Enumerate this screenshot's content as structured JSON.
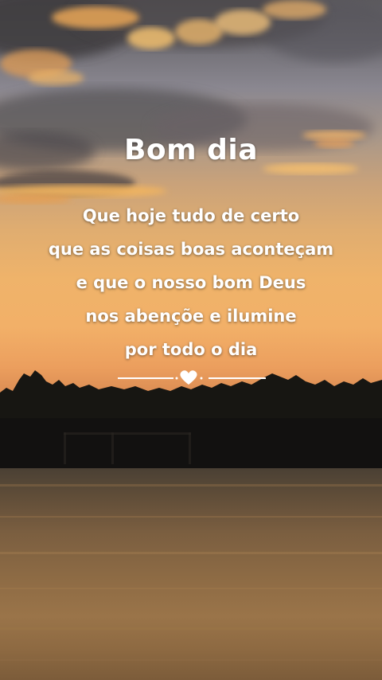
{
  "greeting": {
    "title": "Bom dia",
    "lines": [
      "Que hoje tudo de certo",
      "que as coisas boas aconteçam",
      "e que o nosso bom Deus",
      "nos abençõe e ilumine",
      "por todo o dia"
    ]
  },
  "decoration": {
    "divider_icon": "heart-icon"
  },
  "colors": {
    "text": "#ffffff",
    "sunset": "#efb36a",
    "silhouette": "#151410"
  }
}
